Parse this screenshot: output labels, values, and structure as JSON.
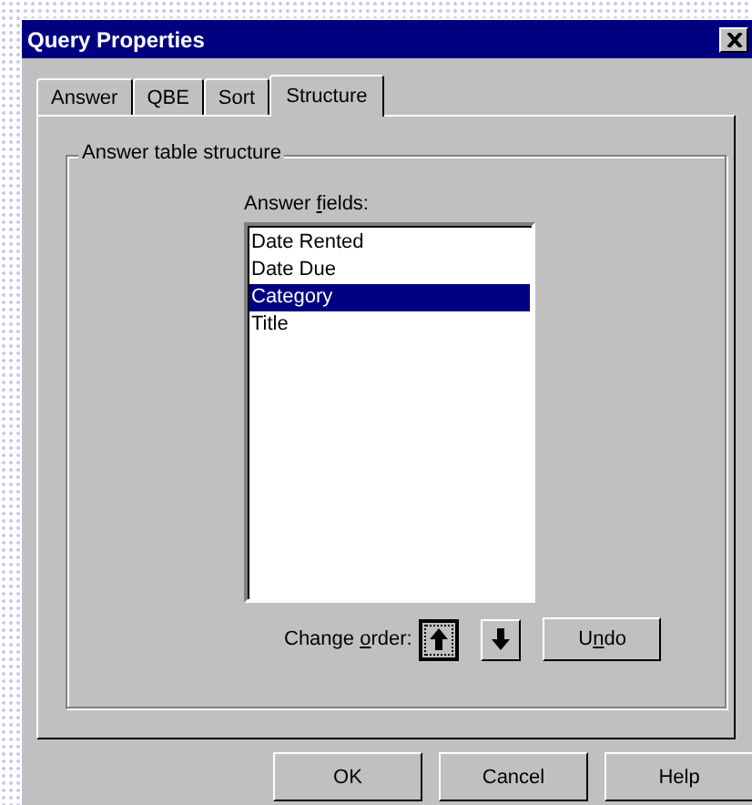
{
  "window": {
    "title": "Query Properties"
  },
  "tabs": [
    {
      "label": "Answer",
      "selected": false
    },
    {
      "label": "QBE",
      "selected": false
    },
    {
      "label": "Sort",
      "selected": false
    },
    {
      "label": "Structure",
      "selected": true
    }
  ],
  "group": {
    "title": "Answer table structure",
    "fields_label": {
      "pre": "Answer ",
      "underlined": "f",
      "post": "ields:"
    },
    "fields": [
      {
        "label": "Date Rented",
        "selected": false
      },
      {
        "label": "Date Due",
        "selected": false
      },
      {
        "label": "Category",
        "selected": true
      },
      {
        "label": "Title",
        "selected": false
      }
    ],
    "order_label": {
      "pre": "Change ",
      "underlined": "o",
      "post": "rder:"
    },
    "order_buttons": [
      {
        "kind": "up",
        "focused": true
      },
      {
        "kind": "down",
        "focused": false
      }
    ],
    "undo": {
      "pre": "U",
      "underlined": "n",
      "post": "do"
    }
  },
  "buttons": [
    "OK",
    "Cancel",
    "Help"
  ]
}
